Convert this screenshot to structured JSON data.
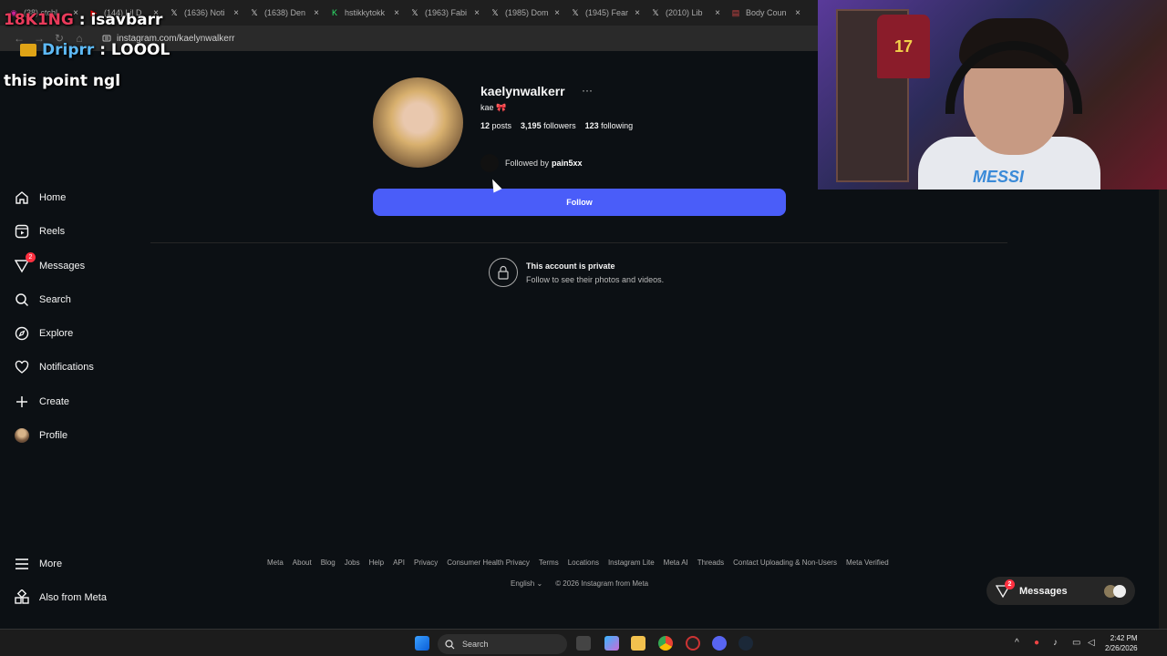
{
  "browser": {
    "tabs": [
      {
        "title": "(38) ctchl",
        "fav": "ig"
      },
      {
        "title": "(144) Lil D",
        "fav": "yt"
      },
      {
        "title": "(1636) Noti",
        "fav": "x"
      },
      {
        "title": "(1638) Den",
        "fav": "x"
      },
      {
        "title": "hstikkytokk",
        "fav": "k"
      },
      {
        "title": "(1963) Fabi",
        "fav": "x"
      },
      {
        "title": "(1985) Dom",
        "fav": "x"
      },
      {
        "title": "(1945) Fear",
        "fav": "x"
      },
      {
        "title": "(2010) Lib",
        "fav": "x"
      },
      {
        "title": "Body Coun",
        "fav": "doc"
      }
    ],
    "url": "instagram.com/kaelynwalkerr"
  },
  "overlay": {
    "line1_user": "18K1NG",
    "line1_msg": ": isavbarr",
    "line2_user": "Driprr",
    "line2_msg": ": LOOOL",
    "line3_msg": "this point ngl"
  },
  "webcam": {
    "jersey_number": "17",
    "shirt_text": "MESSI"
  },
  "sidebar": {
    "items": [
      {
        "label": "Home",
        "icon": "home-icon"
      },
      {
        "label": "Reels",
        "icon": "reels-icon"
      },
      {
        "label": "Messages",
        "icon": "messages-icon",
        "badge": "2"
      },
      {
        "label": "Search",
        "icon": "search-icon"
      },
      {
        "label": "Explore",
        "icon": "explore-icon"
      },
      {
        "label": "Notifications",
        "icon": "heart-icon"
      },
      {
        "label": "Create",
        "icon": "plus-icon"
      },
      {
        "label": "Profile",
        "icon": "avatar"
      }
    ],
    "more": "More",
    "also_from_meta": "Also from Meta"
  },
  "profile": {
    "username": "kaelynwalkerr",
    "more_options": "···",
    "bio": "kae 🎀",
    "posts_count": "12",
    "posts_label": "posts",
    "followers_count": "3,195",
    "followers_label": "followers",
    "following_count": "123",
    "following_label": "following",
    "followed_by_prefix": "Followed by",
    "followed_by_user": "pain5xx",
    "follow_button": "Follow",
    "private_title": "This account is private",
    "private_subtitle": "Follow to see their photos and videos."
  },
  "footer": {
    "links": [
      "Meta",
      "About",
      "Blog",
      "Jobs",
      "Help",
      "API",
      "Privacy",
      "Consumer Health Privacy",
      "Terms",
      "Locations",
      "Instagram Lite",
      "Meta AI",
      "Threads",
      "Contact Uploading & Non-Users",
      "Meta Verified"
    ],
    "language": "English",
    "copyright": "© 2026 Instagram from Meta"
  },
  "messages_pill": {
    "label": "Messages",
    "badge": "2"
  },
  "taskbar": {
    "search_placeholder": "Search",
    "time": "2:42 PM",
    "date": "2/26/2026"
  },
  "colors": {
    "background": "#0c1014",
    "accent": "#4a5df9",
    "badge": "#ff3040"
  }
}
